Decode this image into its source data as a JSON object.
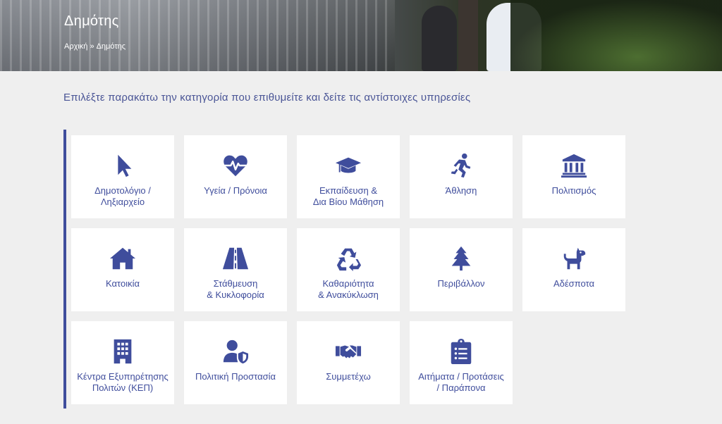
{
  "hero": {
    "title": "Δημότης",
    "breadcrumb": {
      "home": "Αρχική",
      "separator": "»",
      "current": "Δημότης"
    }
  },
  "intro_text": "Επιλέξτε παρακάτω την κατηγορία που επιθυμείτε και δείτε τις αντίστοιχες υπηρεσίες",
  "accent_color": "#3f4d9c",
  "categories": [
    {
      "label": "Δημοτολόγιο /\nΛηξιαρχείο",
      "icon": "pointer-icon"
    },
    {
      "label": "Υγεία / Πρόνοια",
      "icon": "heartbeat-icon"
    },
    {
      "label": "Εκπαίδευση &\nΔια Βίου Μάθηση",
      "icon": "graduation-cap-icon"
    },
    {
      "label": "Άθληση",
      "icon": "running-icon"
    },
    {
      "label": "Πολιτισμός",
      "icon": "landmark-icon"
    },
    {
      "label": "Κατοικία",
      "icon": "house-icon"
    },
    {
      "label": "Στάθμευση\n& Κυκλοφορία",
      "icon": "road-icon"
    },
    {
      "label": "Καθαριότητα\n& Ανακύκλωση",
      "icon": "recycle-icon"
    },
    {
      "label": "Περιβάλλον",
      "icon": "tree-icon"
    },
    {
      "label": "Αδέσποτα",
      "icon": "dog-icon"
    },
    {
      "label": "Κέντρα Εξυπηρέτησης\nΠολιτών (ΚΕΠ)",
      "icon": "building-icon"
    },
    {
      "label": "Πολιτική Προστασία",
      "icon": "user-shield-icon"
    },
    {
      "label": "Συμμετέχω",
      "icon": "handshake-icon"
    },
    {
      "label": "Αιτήματα / Προτάσεις\n/ Παράπονα",
      "icon": "clipboard-list-icon"
    }
  ]
}
